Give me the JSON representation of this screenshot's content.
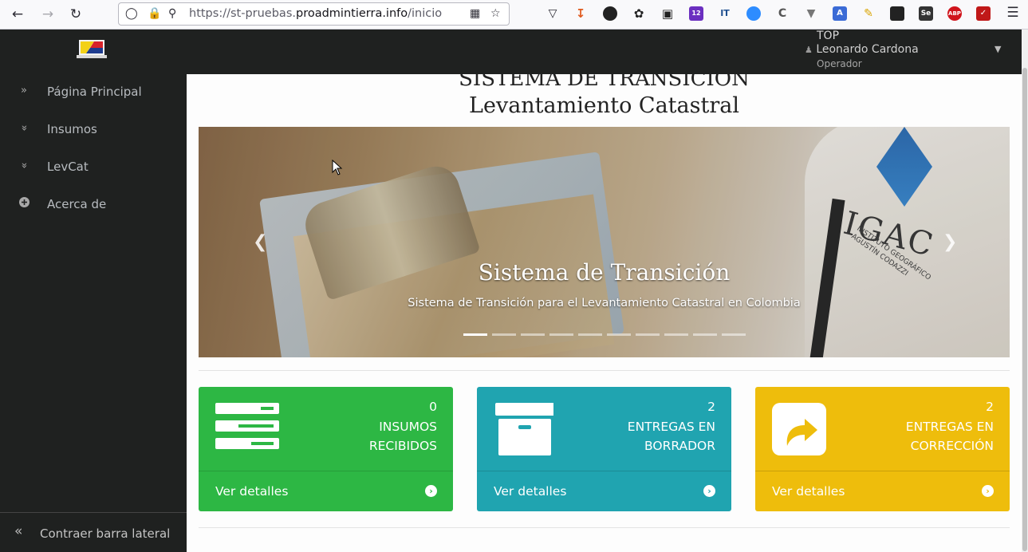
{
  "browser": {
    "back_icon": "arrow-left-icon",
    "forward_icon": "arrow-right-icon",
    "reload_icon": "reload-icon",
    "url_prefix": "https://st-pruebas.",
    "url_domain": "proadmintierra.info",
    "url_path": "/inicio",
    "extension_badge": "12",
    "extension_labels": [
      "IT",
      "Se",
      "ABP"
    ]
  },
  "header": {
    "user_tag": "TOP",
    "user_name": "Leonardo Cardona",
    "user_role": "Operador"
  },
  "sidebar": {
    "items": [
      {
        "label": "Página Principal",
        "icon": "double-chevron-right-icon"
      },
      {
        "label": "Insumos",
        "icon": "double-chevron-down-icon"
      },
      {
        "label": "LevCat",
        "icon": "double-chevron-down-icon"
      },
      {
        "label": "Acerca de",
        "icon": "plus-circle-icon"
      }
    ],
    "collapse_label": "Contraer barra lateral"
  },
  "main": {
    "title_line1": "SISTEMA DE TRANSICIÓN",
    "title_line2": "Levantamiento Catastral",
    "carousel": {
      "slide_title": "Sistema de Transición",
      "slide_subtitle": "Sistema de Transición para el Levantamiento Catastral en Colombia",
      "image_text": "IGAC",
      "image_subtext": "INSTITUTO GEOGRÁFICO AGUSTÍN CODAZZI",
      "indicator_count": 10,
      "active_index": 0
    },
    "cards": [
      {
        "count": "0",
        "label_line1": "INSUMOS",
        "label_line2": "RECIBIDOS",
        "link": "Ver detalles",
        "color": "#2db744",
        "icon": "server-stack-icon"
      },
      {
        "count": "2",
        "label_line1": "ENTREGAS EN",
        "label_line2": "BORRADOR",
        "link": "Ver detalles",
        "color": "#20a4b0",
        "icon": "archive-box-icon"
      },
      {
        "count": "2",
        "label_line1": "ENTREGAS EN",
        "label_line2": "CORRECCIÓN",
        "link": "Ver detalles",
        "color": "#eebd0c",
        "icon": "share-arrow-icon"
      }
    ]
  }
}
